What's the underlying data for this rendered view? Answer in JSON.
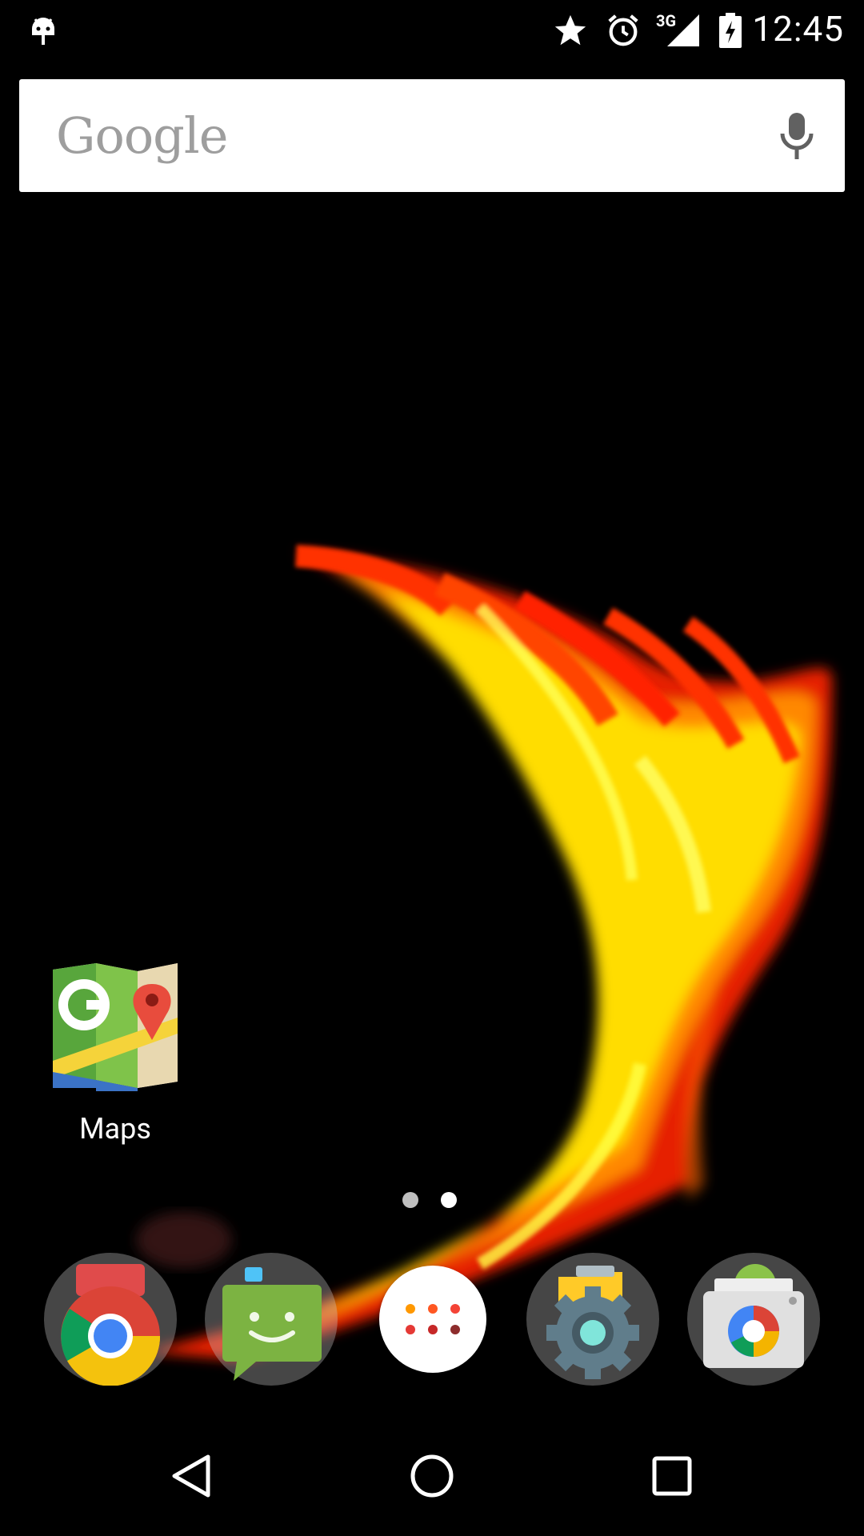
{
  "status_bar": {
    "time": "12:45",
    "network": "3G",
    "icons": [
      "android-debug-icon",
      "star-icon",
      "alarm-icon",
      "signal-icon",
      "battery-charging-icon"
    ]
  },
  "search": {
    "logo": "Google",
    "icon": "mic-icon"
  },
  "home_screen": {
    "apps": [
      {
        "label": "Maps",
        "icon": "google-maps-icon"
      }
    ],
    "pages": {
      "count": 2
    }
  },
  "dock": {
    "items": [
      {
        "name": "chrome-folder",
        "icon": "chrome-icon"
      },
      {
        "name": "messaging-folder",
        "icon": "messaging-icon"
      },
      {
        "name": "all-apps",
        "icon": "app-drawer-icon"
      },
      {
        "name": "settings-folder",
        "icon": "settings-icon"
      },
      {
        "name": "camera-folder",
        "icon": "camera-icon"
      }
    ]
  },
  "nav": {
    "buttons": [
      "back-icon",
      "home-icon",
      "recents-icon"
    ]
  },
  "colors": {
    "background": "#000000",
    "fire_red": "#ff2200",
    "fire_orange": "#ff8800",
    "fire_yellow": "#ffff33"
  }
}
